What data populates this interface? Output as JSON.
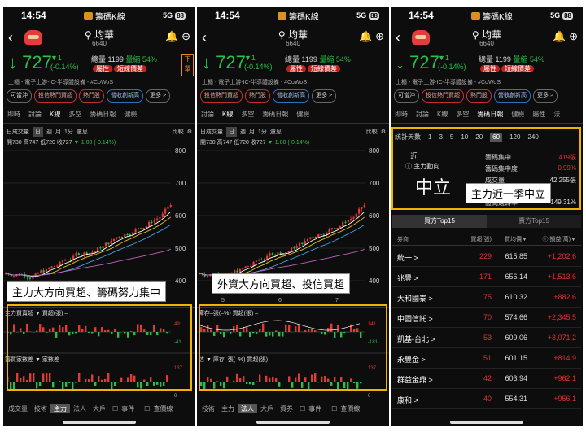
{
  "status": {
    "time": "14:54",
    "app": "籌碼K線",
    "net": "5G",
    "battery": "88"
  },
  "stock": {
    "name": "均華",
    "code": "6640",
    "price": "727",
    "change": "▼1",
    "pct": "(-0.14%)",
    "volume_label": "總量 1199",
    "vratio_label": "量縮 54%",
    "attr_label": "屬性",
    "attr_tag": "短線價差",
    "industry": "上櫃 - 電子上游-IC-半導體設備 - #CoWoS",
    "order_label": "下單"
  },
  "chips": [
    "可當沖",
    "投信熱門買超",
    "熱門股",
    "營收創新高",
    "更多 >"
  ],
  "tabs_main": [
    "即時",
    "討論",
    "K線",
    "多空",
    "籌碼日報",
    "健檢",
    "屬性",
    "法"
  ],
  "toolbar": {
    "period": "日成交量",
    "d": "日",
    "w": "週",
    "m": "月",
    "min": "1分",
    "rights": "還息",
    "compare": "比較"
  },
  "ohlc": {
    "text": "開730 高747 低720 收727",
    "chg": "▼-1.00 (-0.14%)"
  },
  "y_axis": [
    "800",
    "700",
    "600",
    "500",
    "400"
  ],
  "x_axis": [
    "5",
    "6",
    "7"
  ],
  "sub1": {
    "left": "主力買賣超 ▼  買超(張) –",
    "right": "庫存–張(–%) 買超(張) –",
    "vals": [
      "491",
      "-41",
      "141",
      "-181"
    ]
  },
  "sub2": {
    "left": "籌買家數差 ▼  家數差 –",
    "right": "信 ▼ 庫存–張(–%) 買超(張) –",
    "vals": [
      "137",
      "0"
    ]
  },
  "bottom_tabs": [
    "成交量",
    "技術",
    "主力",
    "法人",
    "大戶",
    "資券",
    "事件",
    "查價線"
  ],
  "callouts": {
    "p1": "主力大方向買超、籌碼努力集中",
    "p2": "外資大方向買超、投信買超",
    "p3": "主力近一季中立"
  },
  "p3": {
    "range_label": "統計天數",
    "ranges": [
      "1",
      "3",
      "5",
      "10",
      "20",
      "60",
      "120",
      "240"
    ],
    "period": "近一季",
    "period_prefix": "近",
    "dir_label": "ⓘ 主力動向",
    "dir": "中立",
    "stats": [
      {
        "k": "籌碼集中",
        "v": "419張"
      },
      {
        "k": "籌碼集中度",
        "v": "0.99%"
      },
      {
        "k": "成交量",
        "v": "42,255張"
      },
      {
        "k": "區間週轉率",
        "v": "149.31%"
      }
    ],
    "tab_buy": "買方Top15",
    "tab_sell": "賣方Top15",
    "head": [
      "券商",
      "買超(張)",
      "買均價▼",
      "ⓘ 損益(萬)▼"
    ],
    "rows": [
      {
        "name": "統一 >",
        "buy": "229",
        "avg": "615.85",
        "pl": "+1,202.6"
      },
      {
        "name": "兆豐 >",
        "buy": "171",
        "avg": "656.14",
        "pl": "+1,513.6"
      },
      {
        "name": "大和國泰 >",
        "buy": "75",
        "avg": "610.32",
        "pl": "+882.6"
      },
      {
        "name": "中國信託 >",
        "buy": "70",
        "avg": "574.66",
        "pl": "+2,345.5"
      },
      {
        "name": "凱基-台北 >",
        "buy": "53",
        "avg": "609.06",
        "pl": "+3,071.2"
      },
      {
        "name": "永豐金 >",
        "buy": "51",
        "avg": "601.15",
        "pl": "+814.9"
      },
      {
        "name": "群益金鼎 >",
        "buy": "42",
        "avg": "603.94",
        "pl": "+962.1"
      },
      {
        "name": "康和 >",
        "buy": "40",
        "avg": "554.31",
        "pl": "+956.1"
      }
    ]
  }
}
